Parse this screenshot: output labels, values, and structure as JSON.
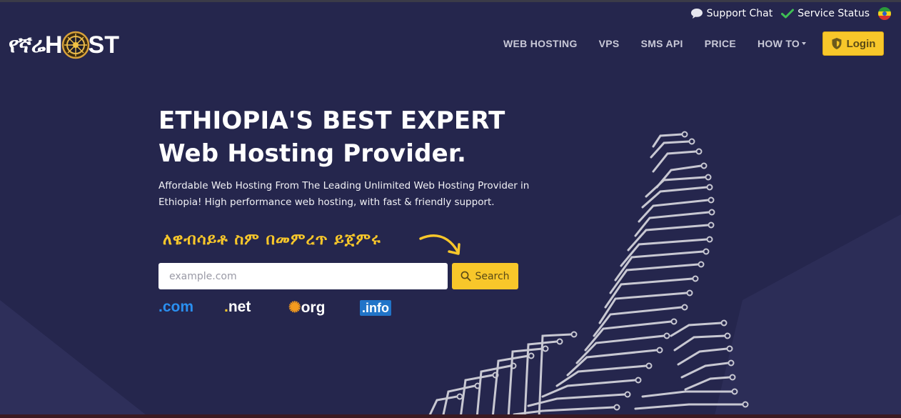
{
  "header": {
    "util": {
      "support_chat": "Support Chat",
      "service_status": "Service Status"
    },
    "logo": {
      "amharic": "የኛሬ",
      "host_h": "H",
      "host_st": "ST"
    },
    "nav": {
      "items": [
        {
          "label": "WEB HOSTING"
        },
        {
          "label": "VPS"
        },
        {
          "label": "SMS API"
        },
        {
          "label": "PRICE"
        },
        {
          "label": "HOW TO"
        }
      ],
      "login": "Login"
    }
  },
  "hero": {
    "title_line1": "ETHIOPIA'S BEST EXPERT",
    "title_line2": "Web Hosting Provider.",
    "description": "Affordable Web Hosting From The Leading Unlimited Web Hosting Provider in Ethiopia! High performance web hosting, with fast & friendly support.",
    "amharic_cta": "ለዌብሳይቶ ስም በመምረጥ ይጀምሩ"
  },
  "search": {
    "placeholder": "example.com",
    "button_label": "Search"
  },
  "tlds": {
    "com": "com",
    "net": "net",
    "org": "org",
    "info": ".info"
  },
  "colors": {
    "background": "#25264d",
    "accent": "#f8c72a",
    "nav_text": "#c9c9d8"
  },
  "icons": [
    "chat-bubble-icon",
    "check-icon",
    "ethiopia-flag-icon",
    "shield-icon",
    "search-icon",
    "curved-arrow-icon"
  ]
}
